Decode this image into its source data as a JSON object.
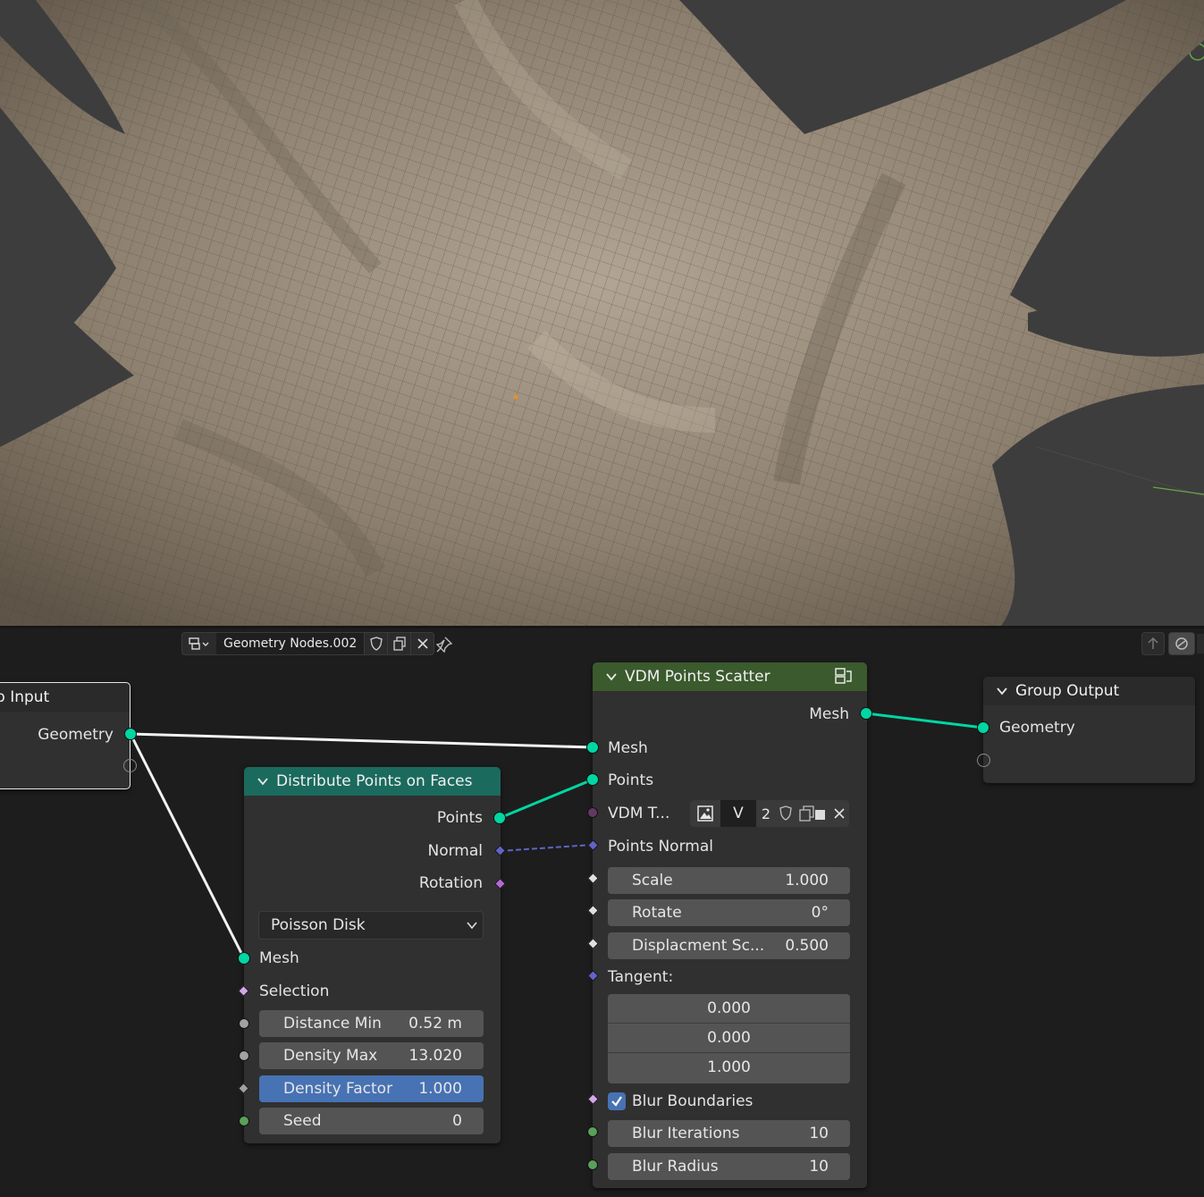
{
  "header": {
    "node_tree_name": "Geometry Nodes.002",
    "icons": [
      "editor-type-icon",
      "chevron-down-icon",
      "fake-user-shield-icon",
      "duplicate-icon",
      "close-icon",
      "pin-icon",
      "parent-node-tree-icon",
      "overlay-icon"
    ]
  },
  "group_input": {
    "title": "p Input",
    "outputs": [
      "Geometry"
    ]
  },
  "distribute_points": {
    "title": "Distribute Points on Faces",
    "header_color": "#1b6a5e",
    "outputs": [
      "Points",
      "Normal",
      "Rotation"
    ],
    "mode": "Poisson Disk",
    "inputs": {
      "mesh": "Mesh",
      "selection": "Selection"
    },
    "fields": [
      {
        "label": "Distance Min",
        "value": "0.52 m"
      },
      {
        "label": "Density Max",
        "value": "13.020"
      },
      {
        "label": "Density Factor",
        "value": "1.000"
      },
      {
        "label": "Seed",
        "value": "0"
      }
    ]
  },
  "vdm_scatter": {
    "title": "VDM Points Scatter",
    "header_color": "#3b5a2d",
    "output": "Mesh",
    "inputs": {
      "mesh": "Mesh",
      "points": "Points",
      "vdm_label": "VDM T...",
      "vdm_image_name": "V",
      "vdm_users": "2",
      "points_normal": "Points Normal",
      "tangent": "Tangent:",
      "blur_boundaries": "Blur Boundaries"
    },
    "fields": [
      {
        "label": "Scale",
        "value": "1.000"
      },
      {
        "label": "Rotate",
        "value": "0°"
      },
      {
        "label": "Displacment Sc...",
        "value": "0.500"
      }
    ],
    "tangent_values": [
      "0.000",
      "0.000",
      "1.000"
    ],
    "blur_boundaries_checked": true,
    "blur_fields": [
      {
        "label": "Blur Iterations",
        "value": "10"
      },
      {
        "label": "Blur Radius",
        "value": "10"
      }
    ]
  },
  "group_output": {
    "title": "Group Output",
    "inputs": [
      "Geometry"
    ]
  },
  "colors": {
    "geometry_socket": "#00d6a3",
    "vector_socket": "#6363c7",
    "rotation_socket": "#b36ad6",
    "active_field": "#4772b3",
    "annotation_underline": "#c8102e",
    "mesh_surface": "#8a7c6c"
  }
}
